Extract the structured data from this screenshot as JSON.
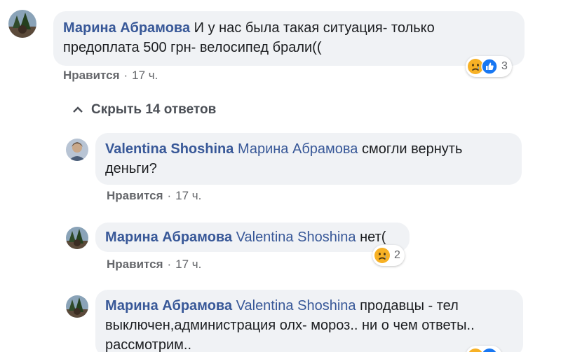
{
  "comments": [
    {
      "author": "Марина Абрамова",
      "text": "И у нас была такая ситуация- только предоплата 500 грн- велосипед брали((",
      "line1": "И у нас была такая ситуация- только",
      "line2": "предоплата 500 грн- велосипед брали((",
      "like_label": "Нравится",
      "time": "17 ч.",
      "reactions": [
        "sad-face",
        "like-thumb"
      ],
      "reaction_count": "3"
    },
    {
      "author": "Valentina Shoshina",
      "mention": "Марина Абрамова",
      "line1": "смогли вернуть",
      "line2": "деньги?",
      "like_label": "Нравится",
      "time": "17 ч."
    },
    {
      "author": "Марина Абрамова",
      "mention": "Valentina Shoshina",
      "line1": "нет(",
      "like_label": "Нравится",
      "time": "17 ч.",
      "reactions": [
        "sad-face"
      ],
      "reaction_count": "2"
    },
    {
      "author": "Марина Абрамова",
      "mention": "Valentina Shoshina",
      "line1": "продавцы - тел",
      "line2": "выключен,администрация олх- мороз.. ни о чем ответы..",
      "line3": "рассмотрим..",
      "reactions": [
        "sad-face",
        "like-thumb"
      ]
    }
  ],
  "replies_toggle": {
    "label": "Скрыть 14 ответов"
  },
  "colors": {
    "bubble_bg": "#f0f2f5",
    "author": "#385898",
    "meta": "#65676b",
    "like_blue": "#1877f2",
    "sad_yellow": "#f7b125"
  }
}
